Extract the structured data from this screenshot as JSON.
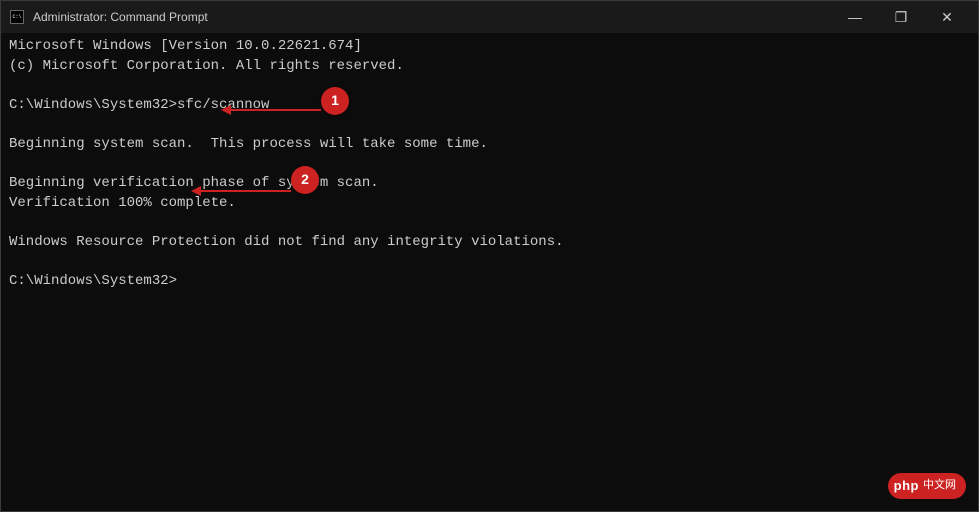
{
  "window": {
    "title": "Administrator: Command Prompt",
    "icon": "cmd-icon"
  },
  "controls": {
    "minimize": "—",
    "maximize": "❐",
    "close": "✕"
  },
  "terminal": {
    "lines": [
      "Microsoft Windows [Version 10.0.22621.674]",
      "(c) Microsoft Corporation. All rights reserved.",
      "",
      "C:\\Windows\\System32>sfc/scannow",
      "",
      "Beginning system scan.  This process will take some time.",
      "",
      "Beginning verification phase of system scan.",
      "Verification 100% complete.",
      "",
      "Windows Resource Protection did not find any integrity violations.",
      "",
      "C:\\Windows\\System32>"
    ]
  },
  "annotations": {
    "badge1": "1",
    "badge2": "2"
  },
  "watermark": {
    "php": "php",
    "cn": "中文网"
  }
}
